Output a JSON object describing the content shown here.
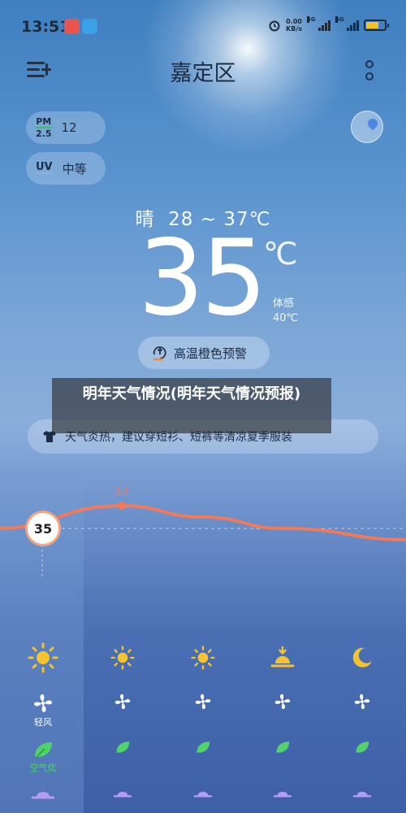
{
  "status_bar": {
    "time": "13:51",
    "net_speed_value": "0.00",
    "net_speed_unit": "KB/s",
    "sim1_label": "5G",
    "sim2_label": "5G",
    "battery_color": "#f3c12b"
  },
  "header": {
    "city": "嘉定区",
    "menu_icon": "menu-add-icon",
    "more_icon": "more-vertical-icon"
  },
  "air": {
    "pm_label_top": "PM",
    "pm_label_bottom": "2.5",
    "pm_value": "12",
    "uv_label": "UV",
    "uv_value": "中等"
  },
  "current": {
    "condition": "晴",
    "range": "28 ~ 37℃",
    "temperature": "35",
    "unit": "℃",
    "feels_like_label": "体感",
    "feels_like_value": "40℃"
  },
  "alert": {
    "text": "高温橙色预警",
    "color": "#f28a3a"
  },
  "overlay_banner": {
    "text": "明年天气情况(明年天气情况预报)"
  },
  "tip": {
    "text": "天气炎热，建议穿短衫、短裤等清凉夏季服装"
  },
  "hourly": {
    "current_temp": "35",
    "max_temp": "37",
    "temps": [
      35,
      37,
      36,
      35,
      34
    ],
    "line_color": "#f07a5a",
    "weather_icons": [
      "sun-icon",
      "sun-icon",
      "sun-icon",
      "sunset-icon",
      "moon-icon"
    ],
    "wind_label": "轻风",
    "air_label": "空气优"
  }
}
